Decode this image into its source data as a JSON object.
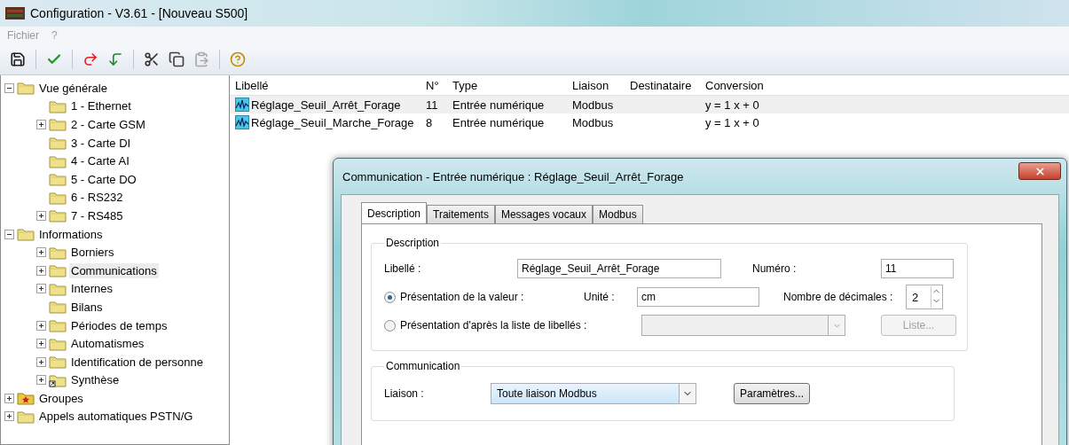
{
  "window": {
    "title": "Configuration - V3.61 - [Nouveau S500]"
  },
  "menu": [
    {
      "label": "Fichier",
      "disabled": true
    },
    {
      "label": "?",
      "disabled": true
    }
  ],
  "toolbar": [
    {
      "kind": "save",
      "disabled": false
    },
    {
      "kind": "validate",
      "disabled": false
    },
    {
      "kind": "undo",
      "disabled": false
    },
    {
      "kind": "redo",
      "disabled": false
    },
    {
      "kind": "cut",
      "disabled": false
    },
    {
      "kind": "copy",
      "disabled": false
    },
    {
      "kind": "paste",
      "disabled": true
    },
    {
      "kind": "help",
      "disabled": false
    }
  ],
  "tree": [
    {
      "label": "Vue générale",
      "expanded": true,
      "kind": "folder",
      "selected": false,
      "children": [
        {
          "label": "1 - Ethernet",
          "kind": "folder",
          "selected": false
        },
        {
          "label": "2 - Carte GSM",
          "expanded": false,
          "kind": "folder",
          "selected": false
        },
        {
          "label": "3 - Carte DI",
          "kind": "folder",
          "selected": false
        },
        {
          "label": "4 - Carte AI",
          "kind": "folder",
          "selected": false
        },
        {
          "label": "5 - Carte DO",
          "kind": "folder",
          "selected": false
        },
        {
          "label": "6 - RS232",
          "kind": "folder",
          "selected": false
        },
        {
          "label": "7 - RS485",
          "expanded": false,
          "kind": "folder",
          "selected": false
        }
      ]
    },
    {
      "label": "Informations",
      "expanded": true,
      "kind": "folder",
      "selected": false,
      "children": [
        {
          "label": "Borniers",
          "expanded": false,
          "kind": "folder",
          "selected": false
        },
        {
          "label": "Communications",
          "expanded": false,
          "kind": "folder",
          "selected": true
        },
        {
          "label": "Internes",
          "expanded": false,
          "kind": "folder",
          "selected": false
        },
        {
          "label": "Bilans",
          "kind": "folder",
          "selected": false
        },
        {
          "label": "Périodes de temps",
          "expanded": false,
          "kind": "folder",
          "selected": false
        },
        {
          "label": "Automatismes",
          "expanded": false,
          "kind": "folder",
          "selected": false
        },
        {
          "label": "Identification de personne",
          "expanded": false,
          "kind": "folder",
          "selected": false
        },
        {
          "label": "Synthèse",
          "expanded": false,
          "kind": "shortcut",
          "selected": false
        }
      ]
    },
    {
      "label": "Groupes",
      "expanded": false,
      "kind": "group",
      "selected": false
    },
    {
      "label": "Appels automatiques PSTN/G",
      "expanded": false,
      "kind": "folder",
      "selected": false
    }
  ],
  "table": {
    "columns": [
      "Libellé",
      "N°",
      "Type",
      "Liaison",
      "Destinataire",
      "Conversion"
    ],
    "rows": [
      {
        "cells": [
          "Réglage_Seuil_Arrêt_Forage",
          "11",
          "Entrée numérique",
          "Modbus",
          "",
          "y = 1 x + 0"
        ],
        "selected": true
      },
      {
        "cells": [
          "Réglage_Seuil_Marche_Forage",
          "8",
          "Entrée numérique",
          "Modbus",
          "",
          "y = 1 x + 0"
        ],
        "selected": false
      }
    ]
  },
  "dialog": {
    "title": "Communication - Entrée numérique : Réglage_Seuil_Arrêt_Forage",
    "tabs": [
      {
        "label": "Description",
        "selected": true
      },
      {
        "label": "Traitements",
        "selected": false
      },
      {
        "label": "Messages vocaux",
        "selected": false
      },
      {
        "label": "Modbus",
        "selected": false
      }
    ],
    "description": {
      "legend": "Description",
      "libelle_label": "Libellé :",
      "libelle_value": "Réglage_Seuil_Arrêt_Forage",
      "numero_label": "Numéro :",
      "numero_value": "11",
      "options": [
        {
          "label": "Présentation de la valeur :",
          "selected": true
        },
        {
          "label": "Présentation d'après la liste de libellés :",
          "selected": false
        }
      ],
      "unite_label": "Unité :",
      "unite_value": "cm",
      "decimales_label": "Nombre de décimales :",
      "decimales_value": "2",
      "liste_combo_disabled": true,
      "liste_button": {
        "label": "Liste...",
        "disabled": true
      }
    },
    "communication": {
      "legend": "Communication",
      "liaison_label": "Liaison :",
      "liaison_value": "Toute liaison Modbus",
      "parametres_button": "Paramètres..."
    }
  }
}
